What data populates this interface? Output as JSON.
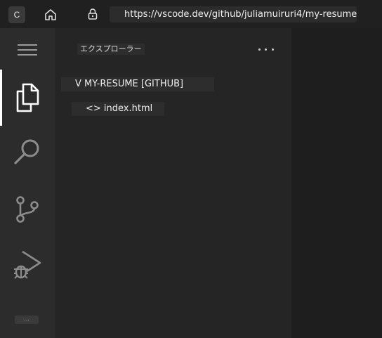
{
  "browser": {
    "tab_letter": "C",
    "url": "https://vscode.dev/github/juliamuiruri4/my-resume"
  },
  "activity_bar": {
    "items": [
      {
        "icon": "menu-icon"
      },
      {
        "icon": "files-icon",
        "active": true
      },
      {
        "icon": "search-icon"
      },
      {
        "icon": "source-control-icon"
      },
      {
        "icon": "run-debug-icon"
      }
    ],
    "bottom_label": "..."
  },
  "sidebar": {
    "title": "エクスプローラー",
    "repo": "V MY-RESUME [GITHUB]",
    "files": [
      {
        "label": "<> index.html"
      }
    ]
  },
  "colors": {
    "browser_bar": "#202020",
    "activity_bar": "#2c2c2c",
    "sidebar": "#252526",
    "editor": "#1e1e1e",
    "text": "#eeeeee"
  }
}
